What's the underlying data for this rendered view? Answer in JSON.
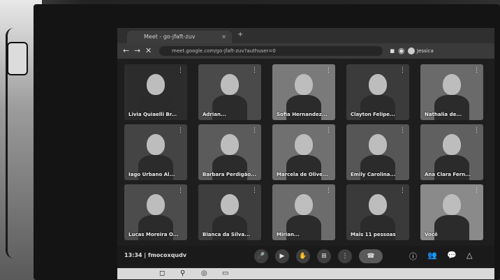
{
  "browser": {
    "tab_title": "Meet - go-jfaft-zuv",
    "tab_close": "×",
    "new_tab": "+",
    "url": "meet.google.com/go-jfaft-zuv?authuser=0",
    "profile_label": "Jessica"
  },
  "participants": [
    {
      "name": "Livia Quiaelli Br...",
      "tile_color": "#2c2c2c"
    },
    {
      "name": "Adrian...",
      "tile_color": "#4a4a4a"
    },
    {
      "name": "Sofia Hernandez...",
      "tile_color": "#7a7a7a"
    },
    {
      "name": "Clayton Felipe...",
      "tile_color": "#3b3b3b"
    },
    {
      "name": "Nathalia de...",
      "tile_color": "#6a6a6a"
    },
    {
      "name": "Iago Urbano Al...",
      "tile_color": "#444444"
    },
    {
      "name": "Barbara Perdigão...",
      "tile_color": "#5b5b5b"
    },
    {
      "name": "Marcela de Olive...",
      "tile_color": "#707070"
    },
    {
      "name": "Emily Carolina...",
      "tile_color": "#565656"
    },
    {
      "name": "Ana Clara Fern...",
      "tile_color": "#606060"
    },
    {
      "name": "Lucas Moreira O...",
      "tile_color": "#4c4c4c"
    },
    {
      "name": "Bianca da Silva...",
      "tile_color": "#3e3e3e"
    },
    {
      "name": "Mirian...",
      "tile_color": "#6c6c6c"
    },
    {
      "name": "Mais 11 pessoas",
      "tile_color": "#3a3a3a"
    },
    {
      "name": "Você",
      "tile_color": "#8a8a8a"
    }
  ],
  "meeting": {
    "time": "13:34",
    "separator": "|",
    "code": "fmocoxqudv"
  },
  "controls": {
    "mic": "🎤",
    "camera": "▶",
    "hand": "✋",
    "present": "⊞",
    "more": "⋮",
    "end": "☎"
  },
  "side_icons": {
    "info": "ⓘ",
    "people": "👥",
    "chat": "💬",
    "activities": "△"
  }
}
